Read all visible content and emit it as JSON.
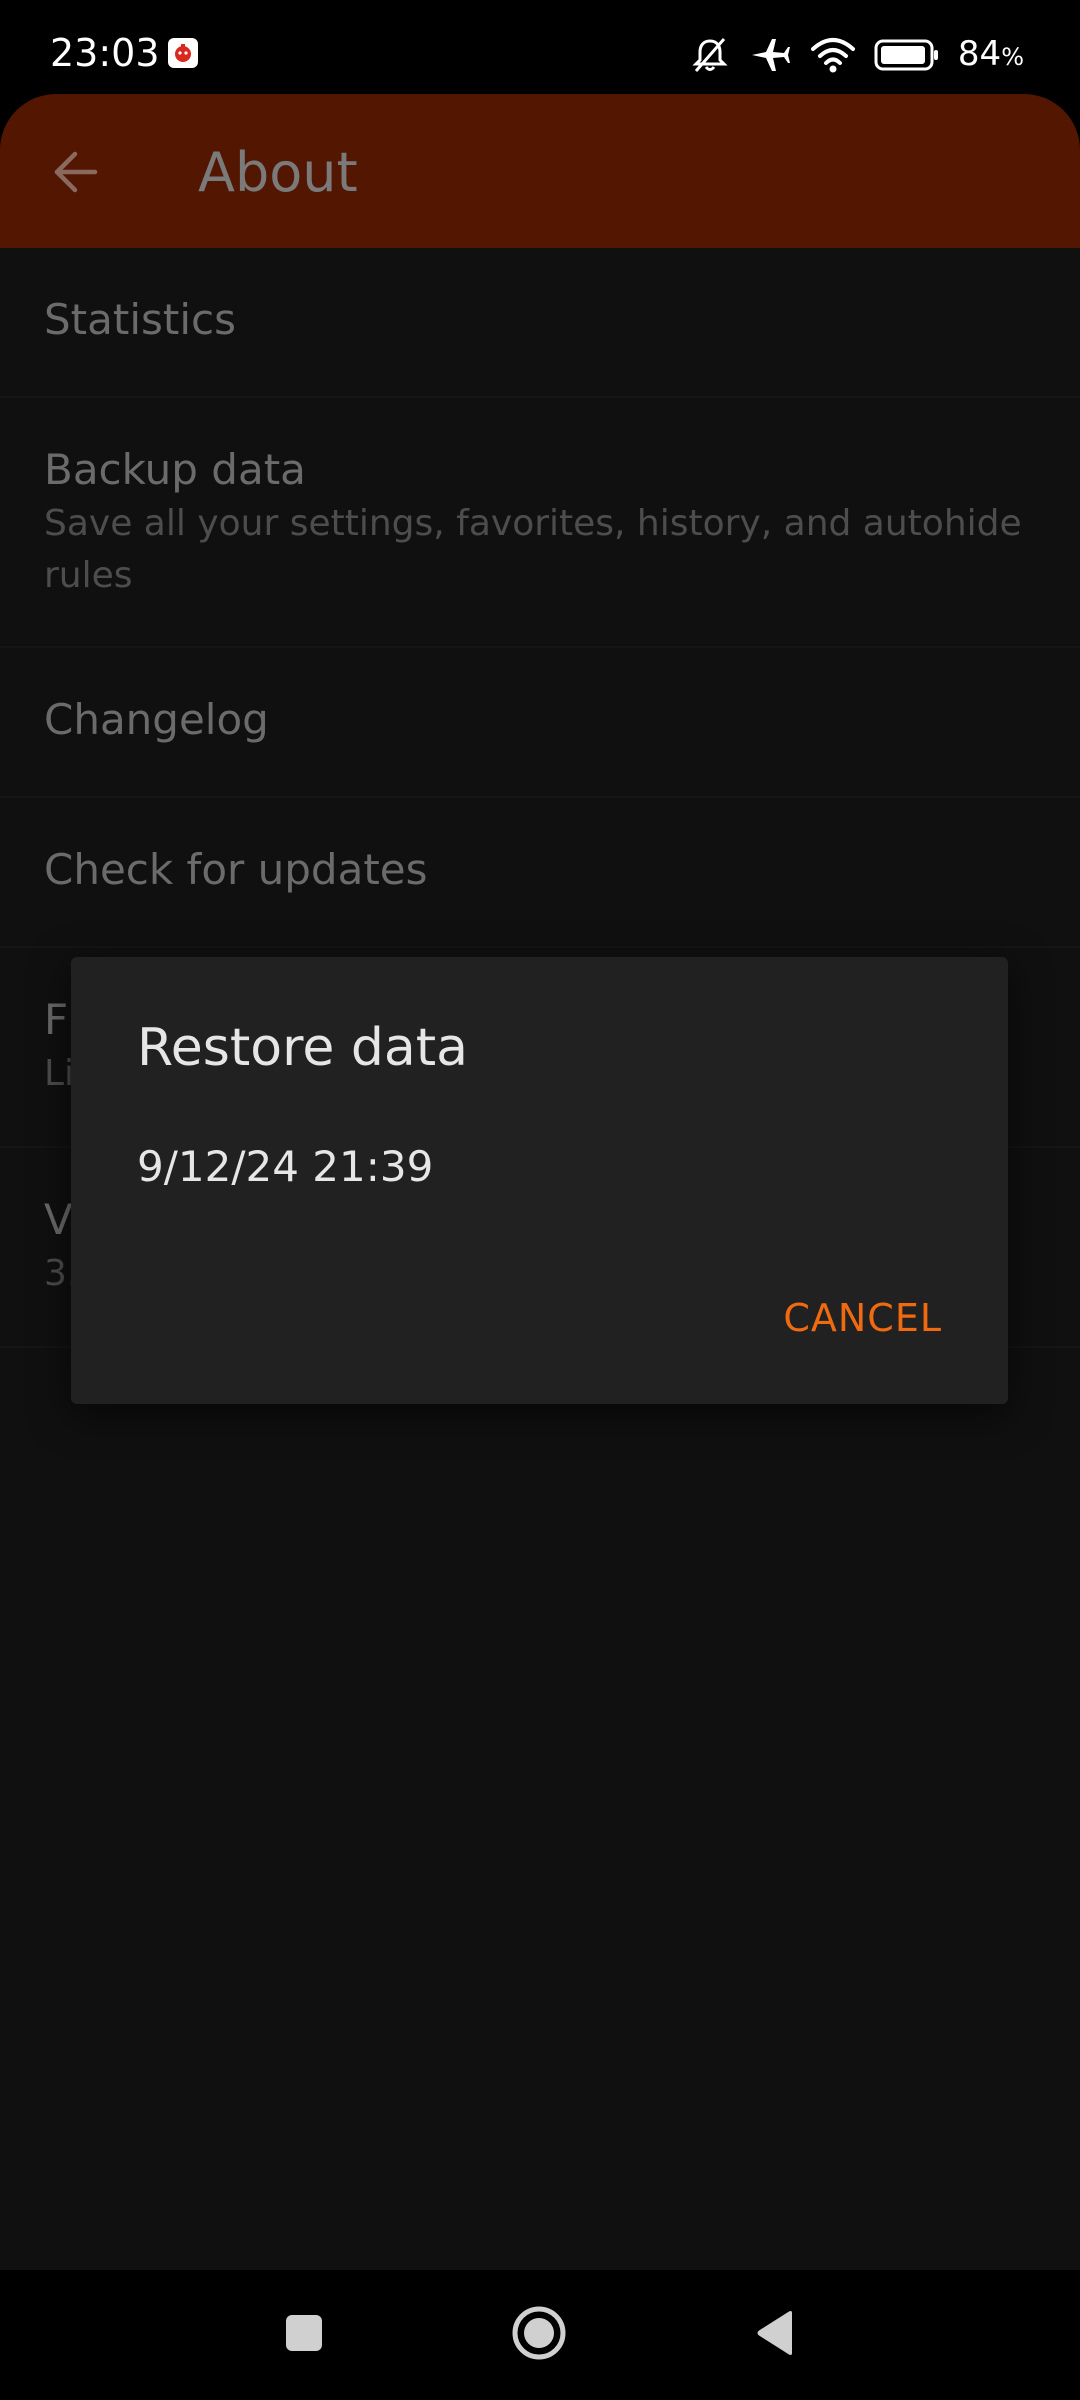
{
  "status_bar": {
    "time": "23:03",
    "battery_level": "84",
    "battery_unit": "%",
    "icons": [
      "app-notification-icon",
      "bell-muted-icon",
      "airplane-icon",
      "wifi-icon",
      "battery-icon"
    ]
  },
  "app_bar": {
    "title": "About",
    "back_icon": "arrow-back-icon"
  },
  "list": {
    "items": [
      {
        "title": "Statistics"
      },
      {
        "title": "Backup data",
        "subtitle": "Save all your settings, favorites, history, and autohide rules"
      },
      {
        "title": "Changelog"
      },
      {
        "title": "Check for updates"
      },
      {
        "title": "F",
        "subtitle": "Li"
      },
      {
        "title": "V",
        "subtitle": "3."
      }
    ]
  },
  "dialog": {
    "title": "Restore data",
    "items": [
      "9/12/24 21:39"
    ],
    "cancel_label": "CANCEL"
  },
  "nav_bar": {
    "icons": [
      "recents-square-icon",
      "home-circle-icon",
      "back-triangle-icon"
    ]
  },
  "colors": {
    "app_bar": "#531600",
    "accent": "#f06a10",
    "background": "#101010",
    "dialog": "#212121"
  }
}
